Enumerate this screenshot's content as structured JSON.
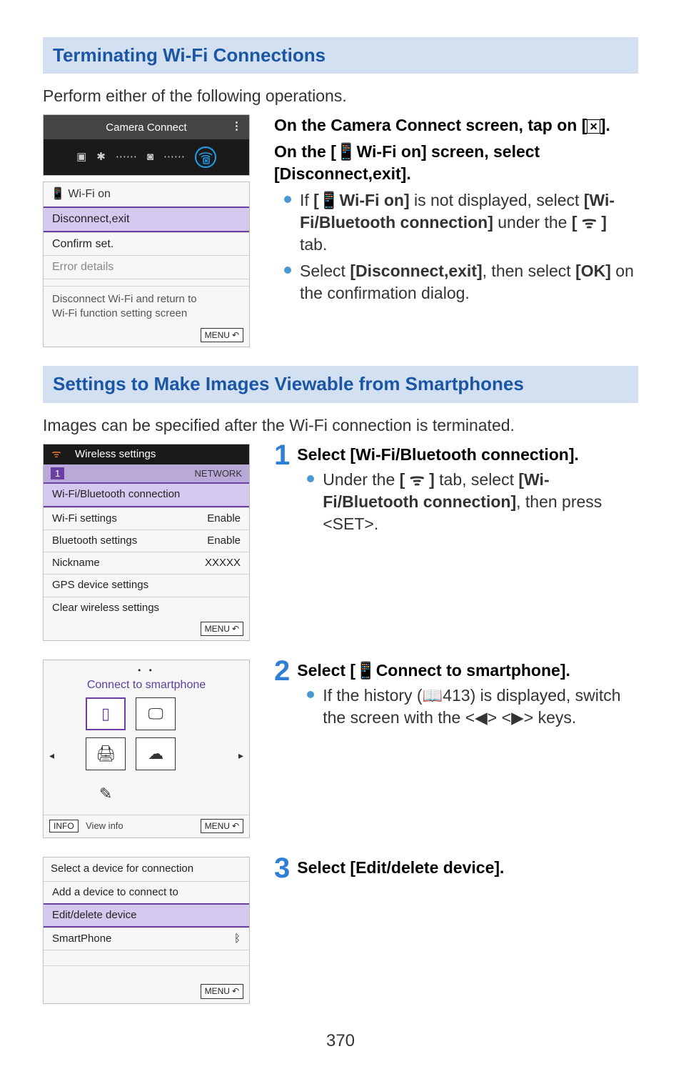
{
  "section1_title": "Terminating Wi-Fi Connections",
  "section1_intro": "Perform either of the following operations.",
  "cc_screen": {
    "title": "Camera Connect",
    "kebab": "⋮",
    "iconbar": {
      "album": "▣",
      "bt": "✱",
      "dots_sep": "⋯⋯",
      "cam": "◙",
      "wifi_x": "×"
    }
  },
  "wifi_menu": {
    "title_icon": "📱",
    "title_text": "Wi-Fi on",
    "items": [
      "Disconnect,exit",
      "Confirm set.",
      "Error details"
    ],
    "hint_line1": "Disconnect Wi-Fi and return to",
    "hint_line2": "Wi-Fi function setting screen",
    "menu_label": "MENU",
    "menu_back": "↶"
  },
  "instr1": {
    "line1_a": "On the Camera Connect screen, tap on [",
    "line1_icon": "×",
    "line1_b": "].",
    "line2": "On the [📱Wi-Fi on] screen, select [Disconnect,exit].",
    "bullets": [
      {
        "pre": "If ",
        "bold": "[📱Wi-Fi on]",
        "post": " is not displayed, select ",
        "bold2": "[Wi-Fi/Bluetooth connection]",
        "post2": " under the ",
        "bold3": "[ ᯤ ]",
        "post3": " tab."
      },
      {
        "pre": "Select ",
        "bold": "[Disconnect,exit]",
        "post": ", then select ",
        "bold2": "[OK]",
        "post2": " on the confirmation dialog."
      }
    ]
  },
  "section2_title": "Settings to Make Images Viewable from Smartphones",
  "section2_intro": "Images can be specified after the Wi-Fi connection is terminated.",
  "ws_screen": {
    "tab_icon": "ᯤ",
    "title": "Wireless settings",
    "subtab": "1",
    "network_label": "NETWORK",
    "rows": [
      {
        "k": "Wi-Fi/Bluetooth connection",
        "v": ""
      },
      {
        "k": "Wi-Fi settings",
        "v": "Enable"
      },
      {
        "k": "Bluetooth settings",
        "v": "Enable"
      },
      {
        "k": "Nickname",
        "v": "XXXXX"
      },
      {
        "k": "GPS device settings",
        "v": ""
      },
      {
        "k": "Clear wireless settings",
        "v": ""
      }
    ],
    "menu_label": "MENU",
    "menu_back": "↶"
  },
  "step1": {
    "num": "1",
    "title": "Select [Wi-Fi/Bluetooth connection].",
    "b_pre": "Under the ",
    "b_b1": "[ ᯤ ]",
    "b_mid": " tab, select ",
    "b_b2": "[Wi-Fi/Bluetooth connection]",
    "b_post": ", then press <SET>."
  },
  "cts_screen": {
    "dots": "• •",
    "title": "Connect to smartphone",
    "left": "◂",
    "right": "▸",
    "icons": {
      "phone": "▯",
      "monitor": "🖵",
      "printer": "🖨",
      "cloud": "☁",
      "remote": "✎"
    },
    "info": "INFO",
    "view_info": "View info",
    "menu_label": "MENU",
    "menu_back": "↶"
  },
  "step2": {
    "num": "2",
    "title": "Select [📱Connect to smartphone].",
    "b_pre": "If the history (📖413) is displayed, switch the screen with the <◀> <▶> keys."
  },
  "sd_screen": {
    "title": "Select a device for connection",
    "rows": [
      {
        "k": "Add a device to connect to",
        "v": ""
      },
      {
        "k": "Edit/delete device",
        "v": ""
      },
      {
        "k": "SmartPhone",
        "v": "ᛒ"
      }
    ],
    "menu_label": "MENU",
    "menu_back": "↶"
  },
  "step3": {
    "num": "3",
    "title": "Select [Edit/delete device]."
  },
  "page_number": "370"
}
